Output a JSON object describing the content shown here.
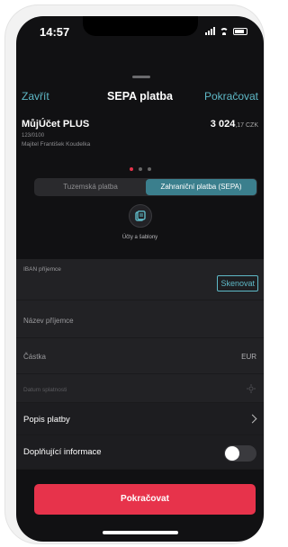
{
  "status": {
    "time": "14:57"
  },
  "nav": {
    "close": "Zavřít",
    "title": "SEPA platba",
    "continue": "Pokračovat"
  },
  "account": {
    "name": "MůjÚčet PLUS",
    "balance": "3 024",
    "balance_decimals": ",17 CZK",
    "number": "123/0100",
    "owner": "Majitel František Koudelka"
  },
  "tabs": [
    {
      "label": "Tuzemská platba",
      "active": false
    },
    {
      "label": "Zahraniční platba (SEPA)",
      "active": true
    }
  ],
  "templates_label": "Účty a šablony",
  "form": {
    "iban_label": "IBAN příjemce",
    "scan_button": "Skenovat",
    "name_label": "Název příjemce",
    "amount_label": "Částka",
    "currency": "EUR",
    "due_date_label": "Datum splatnosti",
    "description_label": "Popis platby",
    "extra_info_label": "Doplňující informace",
    "extra_info_enabled": false
  },
  "cta_label": "Pokračovat",
  "colors": {
    "accent": "#5fb9c7",
    "primary": "#e7334b",
    "background": "#111113"
  }
}
